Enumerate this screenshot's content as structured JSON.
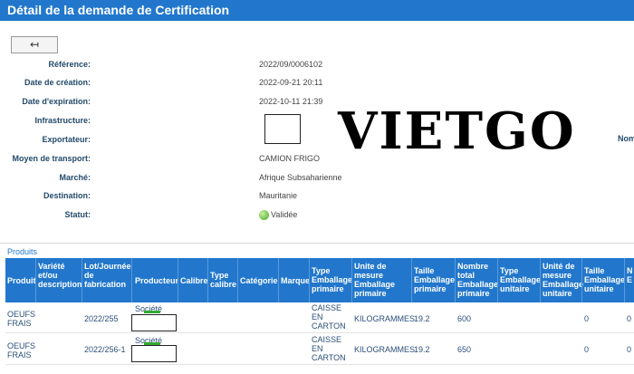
{
  "page": {
    "title": "Détail de la demande de Certification"
  },
  "back_button": {
    "label": "↤"
  },
  "details": {
    "reference": {
      "label": "Référence:",
      "value": "2022/09/0006102"
    },
    "date_creation": {
      "label": "Date de création:",
      "value": "2022-09-21 20:11"
    },
    "date_expiration": {
      "label": "Date d'expiration:",
      "value": "2022-10-11 21:39"
    },
    "infrastructure": {
      "label": "Infrastructure:",
      "value": ""
    },
    "exportateur": {
      "label": "Exportateur:",
      "value": ""
    },
    "moyen_transport": {
      "label": "Moyen de transport:",
      "value": "CAMION FRIGO"
    },
    "marche": {
      "label": "Marché:",
      "value": "Afrique Subsaharienne"
    },
    "destination": {
      "label": "Destination:",
      "value": "Mauritanie"
    },
    "statut": {
      "label": "Statut:",
      "value": "Validée",
      "color": "#44aa22"
    }
  },
  "watermark": {
    "text": "VIETGO"
  },
  "right_cut_label": "Nom",
  "products": {
    "heading": "Produits",
    "columns": {
      "produit": "Produit",
      "variete": "Variété et/ou description",
      "lot": "Lot/Journée de fabrication",
      "producteur": "Producteur",
      "calibre": "Calibre",
      "type_calibre": "Type calibre",
      "categorie": "Catégorie",
      "marque": "Marque",
      "type_emb_prim": "Type Emballage primaire",
      "unite_emb_prim": "Unite de mesure Emballage primaire",
      "taille_emb_prim": "Taille Emballage primaire",
      "nombre_total": "Nombre total Emballage primaire",
      "type_emb_unit": "Type Emballage unitaire",
      "unite_emb_unit": "Unité de mesure Emballage unitaire",
      "taille_emb_unit": "Taille Emballage unitaire",
      "cut_col": "N E"
    },
    "rows": [
      {
        "produit": "OEUFS FRAIS",
        "lot": "2022/255",
        "producteur": "Société",
        "type_emb_prim": "CAISSE EN CARTON",
        "unite_emb_prim": "KILOGRAMMES",
        "taille_emb_prim": "19.2",
        "nombre_total": "600",
        "taille_emb_unit": "0",
        "cut_value": "0"
      },
      {
        "produit": "OEUFS FRAIS",
        "lot": "2022/256-1",
        "producteur": "Société",
        "type_emb_prim": "CAISSE EN CARTON",
        "unite_emb_prim": "KILOGRAMMES",
        "taille_emb_prim": "19.2",
        "nombre_total": "650",
        "taille_emb_unit": "0",
        "cut_value": "0"
      }
    ]
  },
  "colors": {
    "header_blue": "#2277cc",
    "label_navy": "#234a6b"
  }
}
